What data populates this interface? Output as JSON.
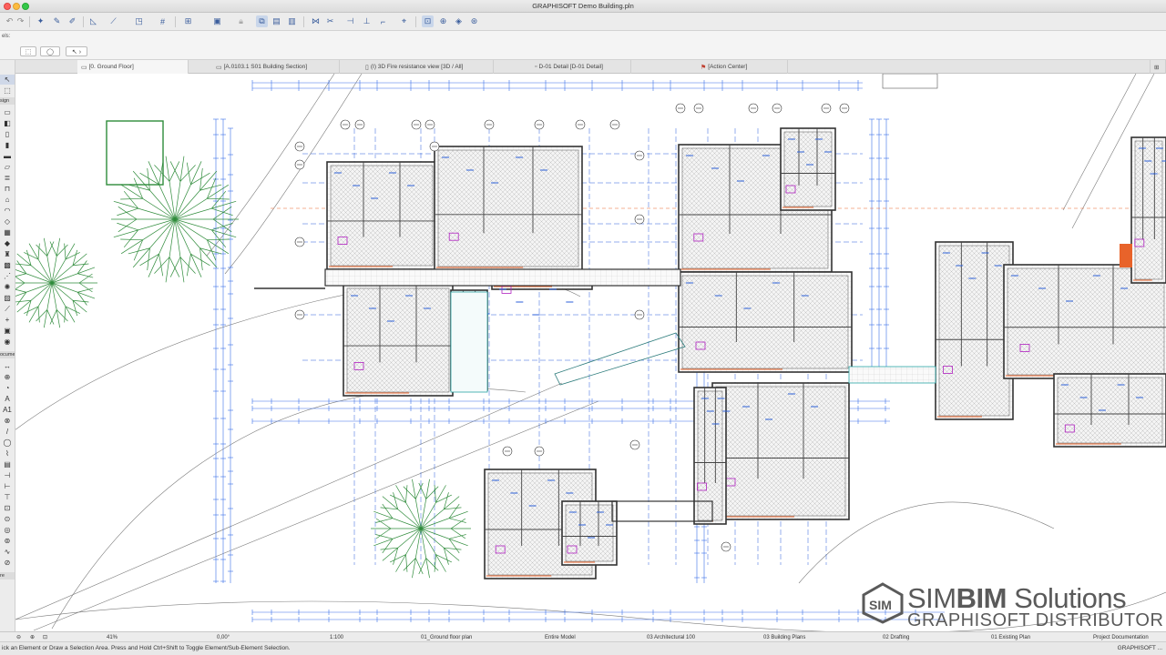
{
  "window": {
    "title": "GRAPHISOFT Demo Building.pln"
  },
  "infobox": {
    "label": "els:"
  },
  "tabs": [
    {
      "label": "[0. Ground Floor]",
      "active": true
    },
    {
      "label": "[A.0103.1 S01 Building Section]",
      "active": false
    },
    {
      "label": "(I) 3D Fire resistance view [3D / All]",
      "active": false
    },
    {
      "label": "D-01 Detail [D-01 Detail]",
      "active": false
    },
    {
      "label": "[Action Center]",
      "active": false
    }
  ],
  "toolbox": {
    "design_label": "sign",
    "document_label": "ocume",
    "more_label": "re",
    "text_tool": "A",
    "label_tool": "A1"
  },
  "quick_options": {
    "zoom": "41%",
    "angle": "0,00°",
    "scale": "1:100",
    "layer_combo": "01_Ground floor plan",
    "structure": "Entire Model",
    "pen_set": "03 Architectural 100",
    "model_view": "03 Building Plans",
    "dimension": "02 Drafting",
    "renovation": "01 Existing Plan",
    "view": "Project Documentation"
  },
  "status": {
    "message": "ick an Element or Draw a Selection Area. Press and Hold Ctrl+Shift to Toggle Element/Sub-Element Selection.",
    "right": "GRAPHISOFT ..."
  },
  "watermark": {
    "line1_a": "SIM",
    "line1_b": "BIM",
    "line1_c": " Solutions",
    "line2": "GRAPHISOFT DISTRIBUTOR",
    "logo_text": "SIM"
  },
  "colors": {
    "wall": "#333333",
    "grid": "#2b5fd9",
    "dimension": "#3a6ee8",
    "tree": "#2e8b3a",
    "accent": "#e8632a"
  }
}
